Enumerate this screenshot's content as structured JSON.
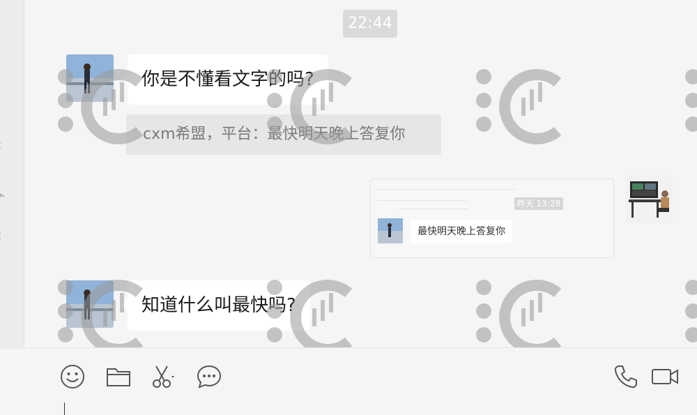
{
  "chat": {
    "timestamp": "22:44",
    "messages": [
      {
        "text": "你是不懂看文字的吗?"
      },
      {
        "text": "知道什么叫最快吗?"
      }
    ],
    "quote": {
      "text": "cxm希盟，平台：最快明天晚上答复你"
    },
    "image_message": {
      "time_label": "昨天 13:28",
      "inner_text": "最快明天晚上答复你"
    }
  },
  "toolbar": {
    "icons": [
      "emoji-icon",
      "folder-icon",
      "scissors-icon",
      "chat-bubble-icon",
      "phone-icon",
      "video-icon"
    ]
  },
  "colors": {
    "background": "#f5f5f5",
    "bubble": "#ffffff",
    "quote_bg": "#e6e6e6",
    "icon": "#555555",
    "watermark": "#9a9a9a"
  }
}
